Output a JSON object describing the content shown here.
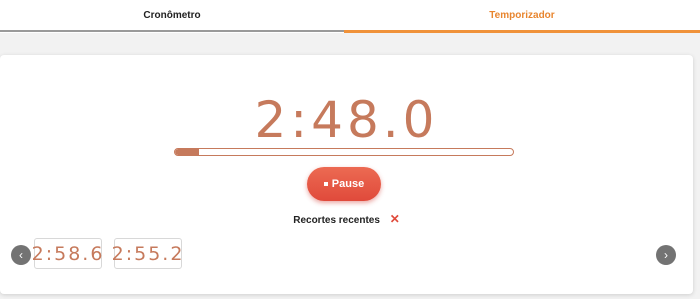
{
  "tabs": {
    "stopwatch": "Cronômetro",
    "timer": "Temporizador"
  },
  "timer": {
    "display": "2:48.0",
    "progress": 0.07,
    "pause_label": "Pause"
  },
  "recent": {
    "title": "Recortes recentes",
    "clear_symbol": "✕",
    "clips": [
      "2:58.6",
      "2:55.2"
    ],
    "prev_symbol": "‹",
    "next_symbol": "›"
  },
  "colors": {
    "accent": "#f0923a",
    "time": "#c67a5c",
    "pause_button": "#e04a3b"
  }
}
